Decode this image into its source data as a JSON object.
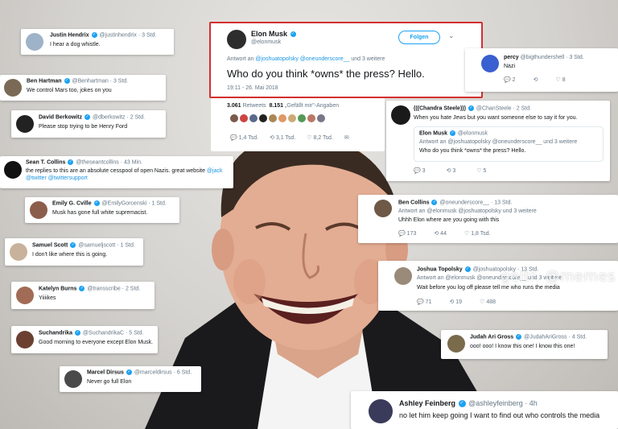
{
  "tweets": [
    {
      "name": "Justin Hendrix",
      "handle": "@justinhendrix",
      "time": "· 3 Std.",
      "text": "I hear a dog whistle."
    },
    {
      "name": "Ben Hartman",
      "handle": "@Benhartman",
      "time": "· 3 Std.",
      "text": "We control Mars too, jokes on you"
    },
    {
      "name": "David Berkowitz",
      "handle": "@dberkowitz",
      "time": "· 2 Std.",
      "text": "Please stop trying to be Henry Ford"
    },
    {
      "name": "Sean T. Collins",
      "handle": "@theseantcollins",
      "time": "· 43 Min.",
      "text": "the replies to this are an absolute cesspool of open Nazis. great website",
      "link1": "@jack",
      "link2": "@twitter @twittersupport"
    },
    {
      "name": "Emily G. Cville",
      "handle": "@EmilyGorcenski",
      "time": "· 1 Std.",
      "text": "Musk has gone full white supremacist."
    },
    {
      "name": "Samuel Scott",
      "handle": "@samueljscott",
      "time": "· 1 Std.",
      "text": "I don't like where this is going."
    },
    {
      "name": "Katelyn Burns",
      "handle": "@transscribe",
      "time": "· 2 Std.",
      "text": "Yiiiikes"
    },
    {
      "name": "Suchandrika",
      "handle": "@SuchandrikaC",
      "time": "· 5 Std.",
      "text": "Good morning to everyone except Elon Musk."
    },
    {
      "name": "Marcel Dirsus",
      "handle": "@marceldirsus",
      "time": "· 6 Std.",
      "text": "Never go full Elon"
    }
  ],
  "main_tweet": {
    "name": "Elon Musk",
    "handle": "@elonmusk",
    "follow_label": "Folgen",
    "reply_to": "Antwort an",
    "reply_handles": "@joshuatopolsky @oneunderscore__",
    "reply_more": "und 3 weitere",
    "text": "Who do you think *owns* the press? Hello.",
    "timestamp": "19:11 - 26. Mai 2018",
    "retweets_num": "3.061",
    "retweets_label": "Retweets",
    "likes_num": "8.151",
    "likes_label": "„Gefällt mir\"-Angaben",
    "replies": "1,4 Tsd.",
    "retweets_short": "3,1 Tsd.",
    "likes_short": "8,2 Tsd."
  },
  "percy": {
    "name": "percy",
    "handle": "@bigthundershell",
    "time": "· 3 Std.",
    "text": "Nazi",
    "replies": "2",
    "retweets": "",
    "likes": "8"
  },
  "chandra": {
    "name": "(((Chandra Steele)))",
    "handle": "@ChanSteele",
    "time": "· 2 Std.",
    "text": "When you hate Jews but you want someone else to say it for you.",
    "quote_name": "Elon Musk",
    "quote_handle": "@elonmusk",
    "quote_reply": "Antwort an @joshuatopolsky @oneunderscore__ und 3 weitere",
    "quote_text": "Who do you think *owns* the press? Hello.",
    "replies": "3",
    "retweets": "3",
    "likes": "5"
  },
  "ben_collins": {
    "name": "Ben Collins",
    "handle": "@oneunderscore__",
    "time": "· 13 Std.",
    "reply": "Antwort an @elonmusk @joshuatopolsky und 3 weitere",
    "text": "Uhhh Elon where are you going with this",
    "replies": "173",
    "retweets": "44",
    "likes": "1,8 Tsd."
  },
  "topolsky": {
    "name": "Joshua Topolsky",
    "handle": "@joshuatopolsky",
    "time": "· 13 Std.",
    "reply": "Antwort an @elonmusk @oneunderscore__ und 3 weitere",
    "text": "Wait before you log off please tell me who runs the media",
    "replies": "71",
    "retweets": "19",
    "likes": "488"
  },
  "judah": {
    "name": "Judah Ari Gross",
    "handle": "@JudahAriGross",
    "time": "· 4 Std.",
    "text": "ooo! ooo! I know this one! I know this one!"
  },
  "ashley": {
    "name": "Ashley Feinberg",
    "handle": "@ashleyfeinberg",
    "time": "· 4h",
    "text": "no let him keep going I want to find out who controls the media"
  },
  "watermark": "geitr. @memes",
  "colors": {
    "twitter_blue": "#1da1f2",
    "highlight_red": "#d32f2f",
    "gray_text": "#657786"
  }
}
